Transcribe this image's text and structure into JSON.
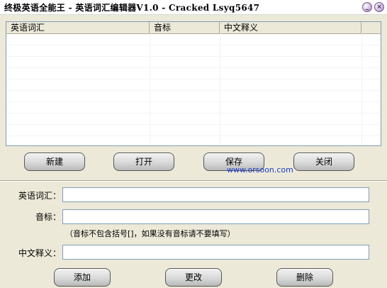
{
  "window": {
    "title": "终极英语全能王 - 英语词汇编辑器V1.0  - Cracked Lsyq5647"
  },
  "title_buttons": {
    "minimize_glyph": "_",
    "close_glyph": "×"
  },
  "vocab_list": {
    "columns": [
      "英语词汇",
      "音标",
      "中文释义"
    ],
    "rows": []
  },
  "file_buttons": {
    "new": "新建",
    "open": "打开",
    "save": "保存",
    "close": "关闭"
  },
  "watermark": "www.orsoon.com",
  "form": {
    "english_label": "英语词汇：",
    "english_value": "",
    "phonetic_label": "音标：",
    "phonetic_value": "",
    "phonetic_note": "（音标不包含括号[]，如果没有音标请不要填写）",
    "chinese_label": "中文释义：",
    "chinese_value": ""
  },
  "action_buttons": {
    "add": "添加",
    "modify": "更改",
    "delete": "删除"
  }
}
